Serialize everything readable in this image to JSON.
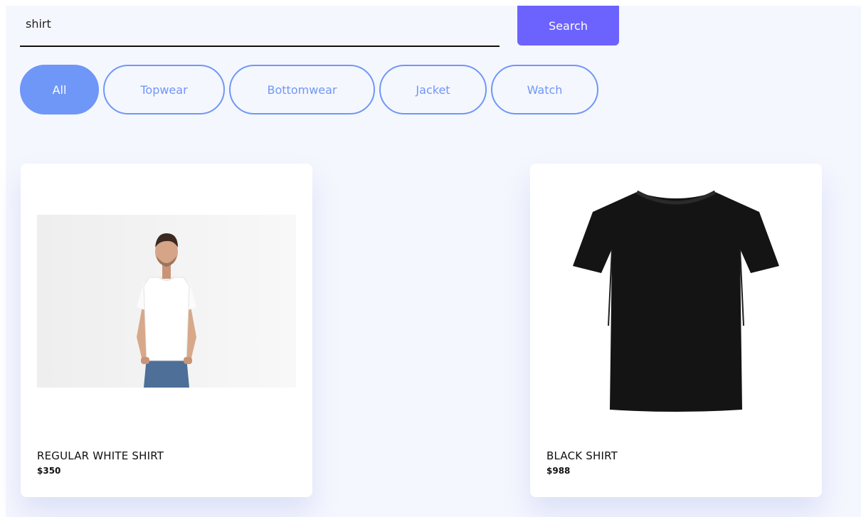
{
  "search": {
    "value": "shirt",
    "button_label": "Search"
  },
  "filters": [
    {
      "label": "All",
      "active": true
    },
    {
      "label": "Topwear",
      "active": false
    },
    {
      "label": "Bottomwear",
      "active": false
    },
    {
      "label": "Jacket",
      "active": false
    },
    {
      "label": "Watch",
      "active": false
    }
  ],
  "products": [
    {
      "name": "REGULAR WHITE SHIRT",
      "price": "$350",
      "image_icon": "man-white-tshirt-photo"
    },
    {
      "name": "BLACK SHIRT",
      "price": "$988",
      "image_icon": "black-tshirt-photo"
    }
  ],
  "colors": {
    "search_button": "#6c63ff",
    "filter_accent": "#6f97f7",
    "background": "#f5f7fe"
  }
}
